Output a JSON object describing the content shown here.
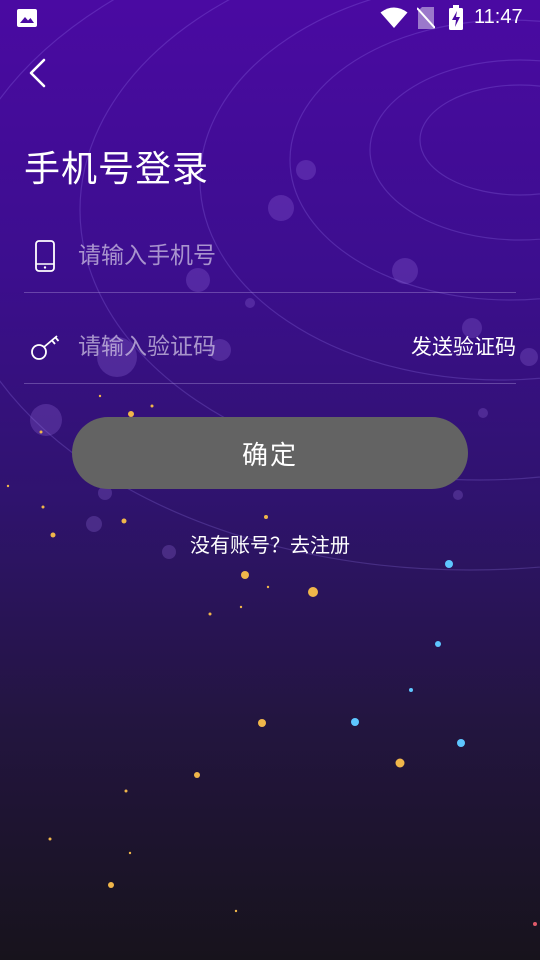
{
  "status_bar": {
    "time": "11:47",
    "icons": [
      "gallery-icon",
      "wifi-icon",
      "no-sim-icon",
      "battery-charging-icon"
    ]
  },
  "header": {
    "back_icon": "chevron-left-icon",
    "title": "手机号登录"
  },
  "form": {
    "phone": {
      "icon": "smartphone-icon",
      "placeholder": "请输入手机号",
      "value": ""
    },
    "code": {
      "icon": "key-icon",
      "placeholder": "请输入验证码",
      "value": "",
      "send_label": "发送验证码"
    },
    "confirm_label": "确定",
    "register_label": "没有账号？去注册"
  },
  "colors": {
    "background_top": "#4a0aa2",
    "background_bottom": "#17131c",
    "button": "#636363",
    "text": "#ffffff"
  }
}
